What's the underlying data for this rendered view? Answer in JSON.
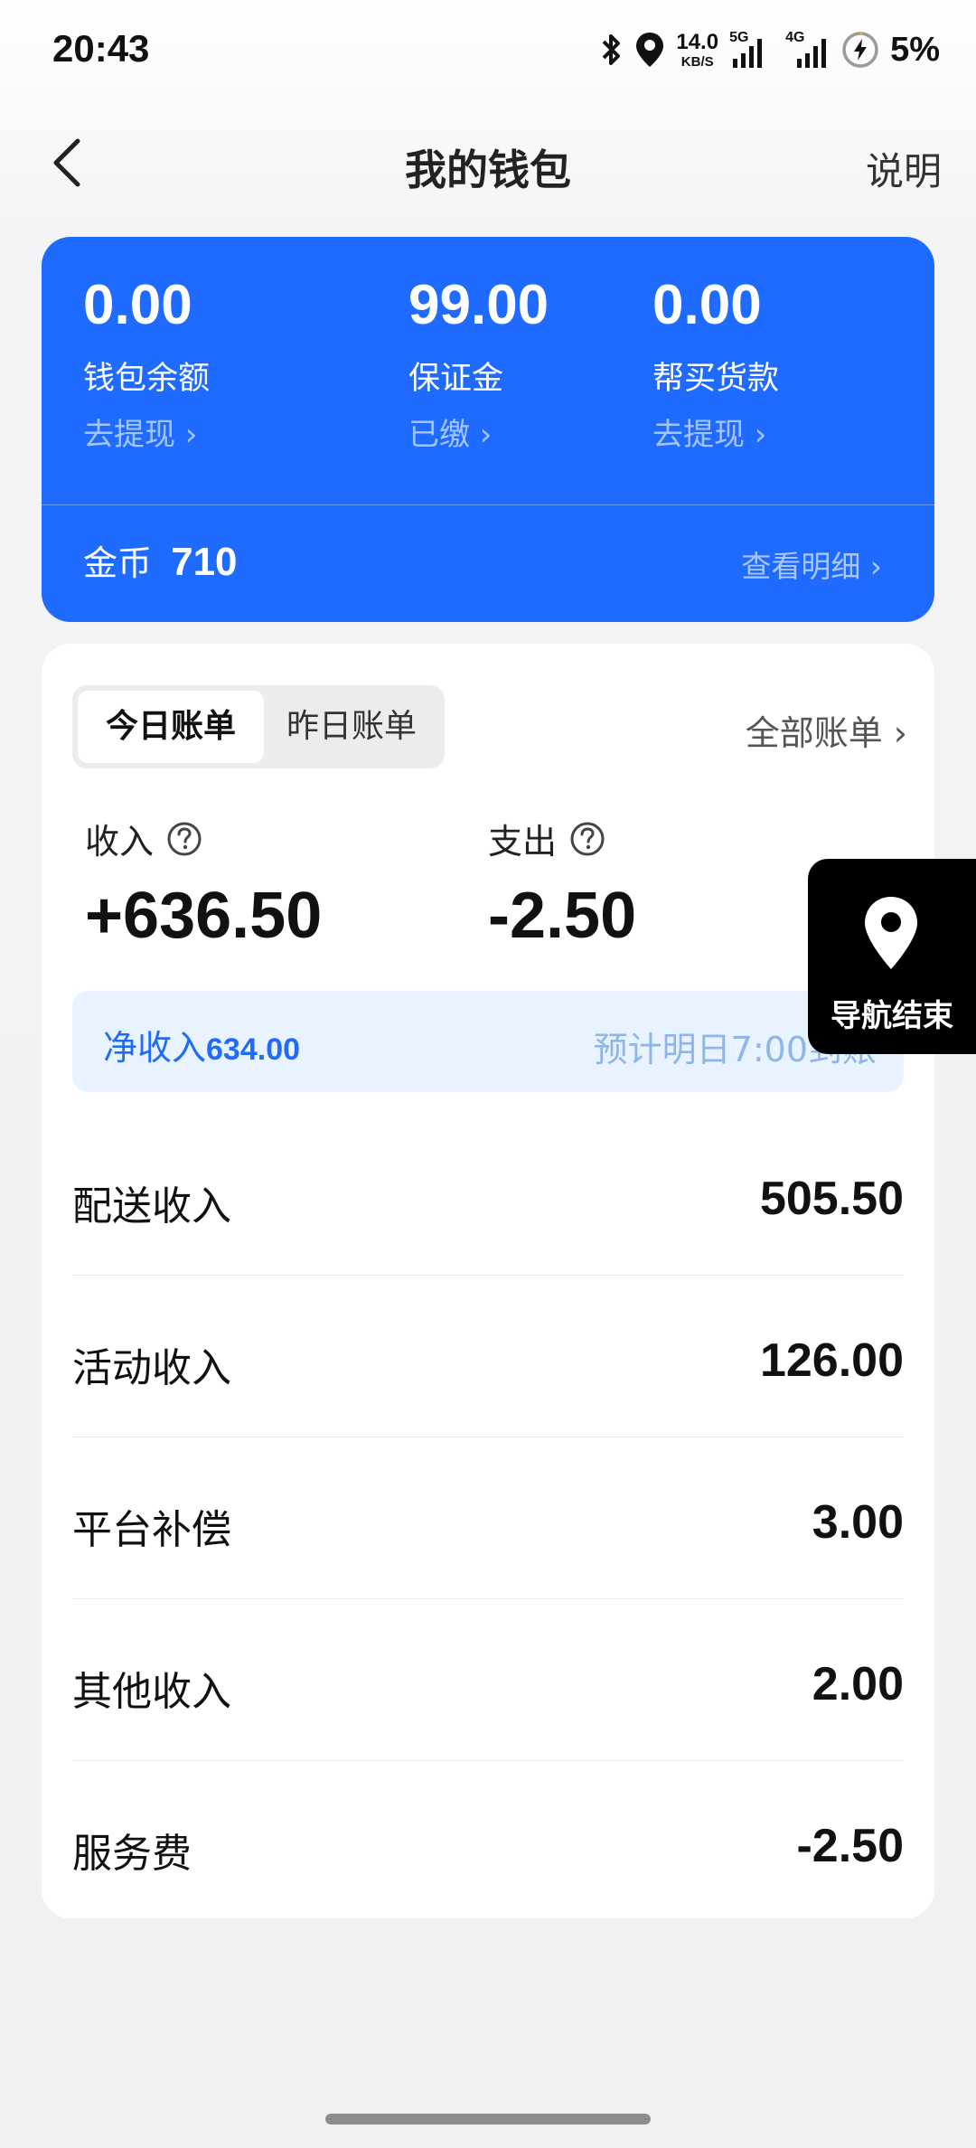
{
  "status_bar": {
    "time": "20:43",
    "net_speed_value": "14.0",
    "net_speed_unit": "KB/S",
    "signal_1_tag": "5G",
    "signal_2_tag": "4G",
    "battery_percent": "5%",
    "icons": [
      "bluetooth-icon",
      "location-icon",
      "signal-icon",
      "signal-icon",
      "battery-charging-icon"
    ]
  },
  "header": {
    "title": "我的钱包",
    "explain_label": "说明",
    "back_icon": "chevron-left-icon"
  },
  "wallet": {
    "balance": {
      "amount": "0.00",
      "label": "钱包余额",
      "action": "去提现 ›"
    },
    "deposit": {
      "amount": "99.00",
      "label": "保证金",
      "action": "已缴 ›"
    },
    "proxy_payment": {
      "amount": "0.00",
      "label": "帮买货款",
      "action": "去提现 ›"
    },
    "coins_label": "金币",
    "coins_value": "710",
    "view_detail": "查看明细 ›",
    "card_color": "#1f6bff"
  },
  "bills": {
    "tabs": [
      {
        "label": "今日账单",
        "active": true
      },
      {
        "label": "昨日账单",
        "active": false
      }
    ],
    "all_bills": "全部账单 ›",
    "income_label": "收入",
    "income_value": "+636.50",
    "expense_label": "支出",
    "expense_value": "-2.50",
    "net_income_label": "净收入",
    "net_income_value": "634.00",
    "arrival_note": "预计明日7:00到账",
    "items": [
      {
        "label": "配送收入",
        "value": "505.50"
      },
      {
        "label": "活动收入",
        "value": "126.00"
      },
      {
        "label": "平台补偿",
        "value": "3.00"
      },
      {
        "label": "其他收入",
        "value": "2.00"
      },
      {
        "label": "服务费",
        "value": "-2.50"
      }
    ]
  },
  "floating": {
    "label": "导航结束",
    "icon": "map-pin-icon"
  }
}
